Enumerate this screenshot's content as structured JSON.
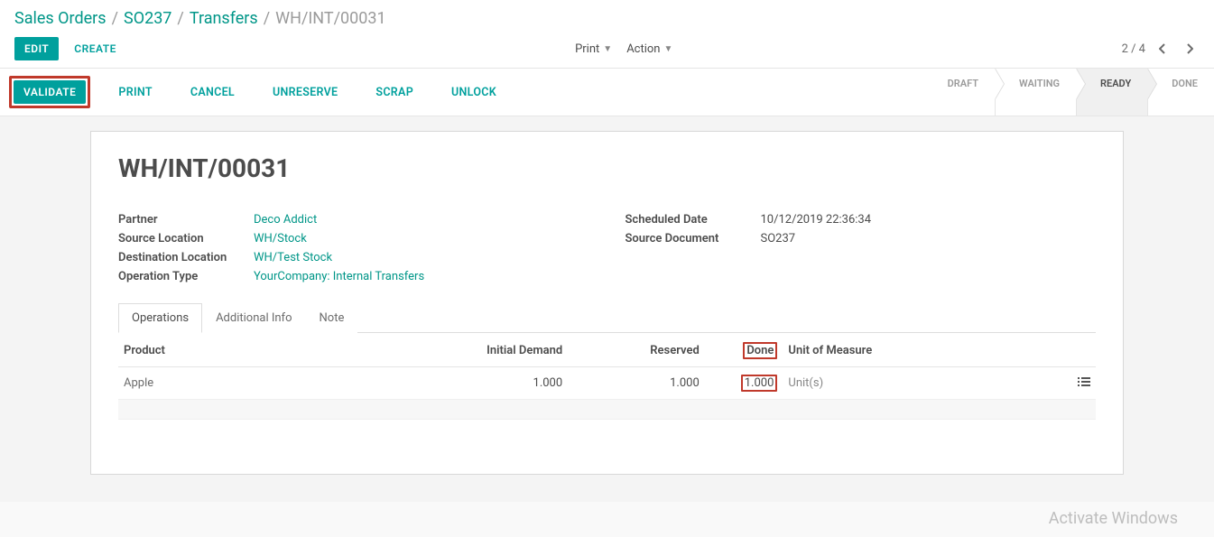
{
  "breadcrumb": {
    "root": "Sales Orders",
    "order": "SO237",
    "transfers": "Transfers",
    "current": "WH/INT/00031"
  },
  "controls": {
    "edit": "EDIT",
    "create": "CREATE",
    "print": "Print",
    "action": "Action",
    "pager": "2 / 4"
  },
  "actionbar": {
    "validate": "VALIDATE",
    "print": "PRINT",
    "cancel": "CANCEL",
    "unreserve": "UNRESERVE",
    "scrap": "SCRAP",
    "unlock": "UNLOCK"
  },
  "status": {
    "draft": "DRAFT",
    "waiting": "WAITING",
    "ready": "READY",
    "done": "DONE"
  },
  "record": {
    "title": "WH/INT/00031",
    "left": {
      "partner_label": "Partner",
      "partner_value": "Deco Addict",
      "src_label": "Source Location",
      "src_value": "WH/Stock",
      "dst_label": "Destination Location",
      "dst_value": "WH/Test Stock",
      "op_label": "Operation Type",
      "op_value": "YourCompany: Internal Transfers"
    },
    "right": {
      "sched_label": "Scheduled Date",
      "sched_value": "10/12/2019 22:36:34",
      "srcdoc_label": "Source Document",
      "srcdoc_value": "SO237"
    }
  },
  "tabs": {
    "operations": "Operations",
    "additional": "Additional Info",
    "note": "Note"
  },
  "grid": {
    "headers": {
      "product": "Product",
      "initial": "Initial Demand",
      "reserved": "Reserved",
      "done": "Done",
      "uom": "Unit of Measure"
    },
    "rows": [
      {
        "product": "Apple",
        "initial": "1.000",
        "reserved": "1.000",
        "done": "1.000",
        "uom": "Unit(s)"
      }
    ]
  },
  "watermark": "Activate Windows"
}
